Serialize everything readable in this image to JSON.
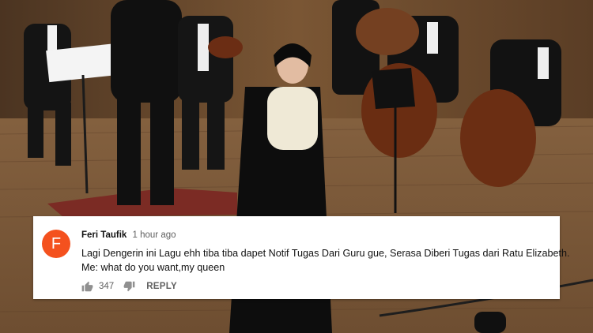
{
  "comment": {
    "avatar_letter": "F",
    "avatar_color": "#f4511e",
    "author": "Feri Taufik",
    "timestamp": "1 hour ago",
    "lines": [
      "Lagi Dengerin ini Lagu ehh tiba tiba dapet Notif Tugas Dari Guru gue, Serasa Diberi Tugas dari Ratu Elizabeth.",
      "Me: what do you want,my queen"
    ],
    "like_count": "347",
    "reply_label": "REPLY",
    "icons": {
      "like": "thumbs-up-icon",
      "dislike": "thumbs-down-icon"
    }
  }
}
